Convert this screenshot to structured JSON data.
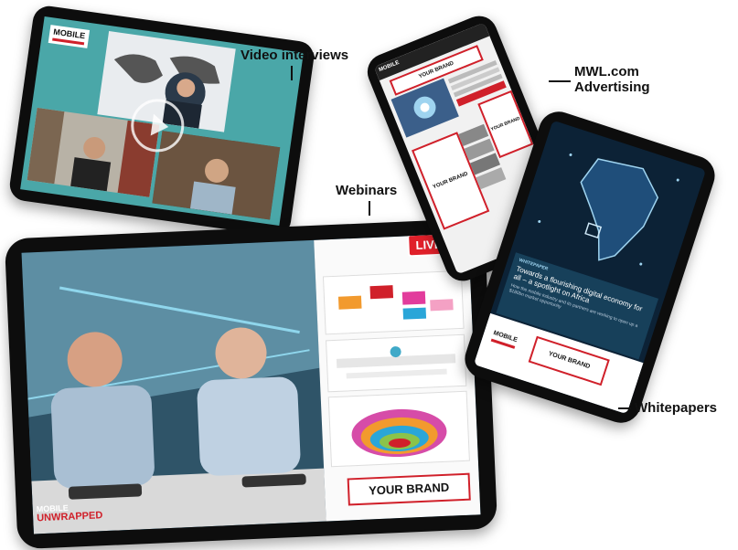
{
  "callouts": {
    "video": "Video interviews",
    "webinars": "Webinars",
    "advertising_line1": "MWL.com",
    "advertising_line2": "Advertising",
    "whitepapers": "Whitepapers"
  },
  "video_tablet": {
    "logo": "MOBILE"
  },
  "webinar_tablet": {
    "live": "LIVE",
    "brand": "YOUR BRAND",
    "logo_top": "MOBILE",
    "logo_bottom": "UNWRAPPED"
  },
  "ad_phone": {
    "logo": "MOBILE",
    "brand_top": "YOUR BRAND",
    "brand_left": "YOUR BRAND",
    "brand_right": "YOUR BRAND"
  },
  "wp_phone": {
    "label": "WHITEPAPER",
    "title": "Towards a flourishing digital economy for all – a spotlight on Africa",
    "subtitle": "How the mobile industry and its partners are working to open up a $180bn market opportunity",
    "logo": "MOBILE",
    "brand": "YOUR BRAND"
  },
  "colors": {
    "accent_red": "#d0202a",
    "teal": "#4aa7a8",
    "navy": "#0c2236"
  }
}
